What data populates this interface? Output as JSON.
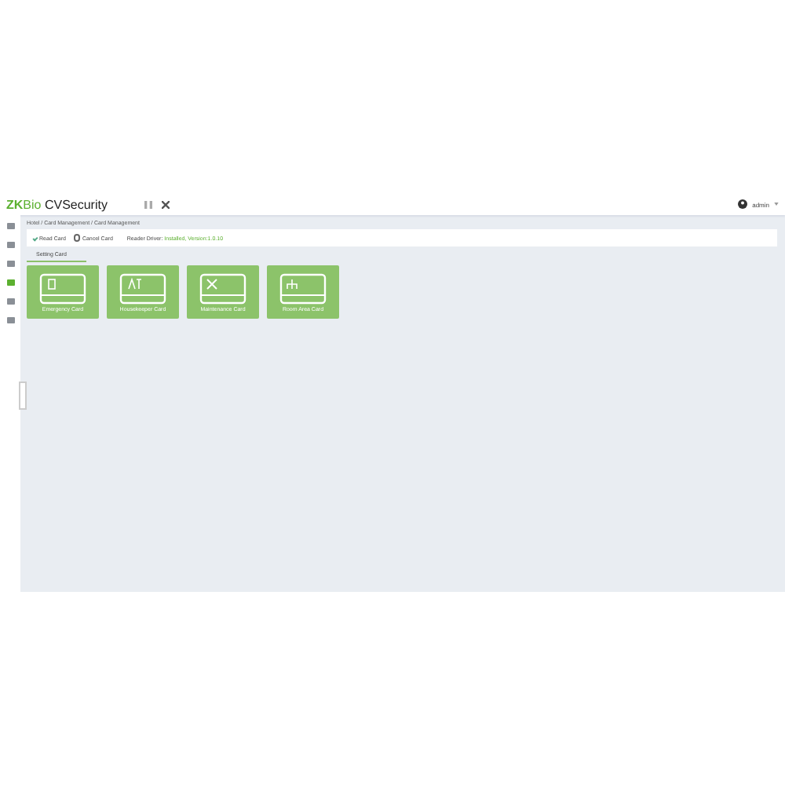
{
  "header": {
    "logo_mark": "ZK",
    "logo_brand": "Bio",
    "product": "CVSecurity",
    "user": "admin"
  },
  "sidebar": {
    "items": [
      {
        "selected": false
      },
      {
        "selected": false
      },
      {
        "selected": false
      },
      {
        "selected": true
      },
      {
        "selected": false
      },
      {
        "selected": false
      }
    ]
  },
  "breadcrumb": "Hotel / Card Management / Card Management",
  "toolbar": {
    "buttons": [
      {
        "label": "Read Card",
        "kind": "check"
      },
      {
        "label": "Cancel Card",
        "kind": "cancel"
      }
    ],
    "driver_label": "Reader Driver:",
    "driver_status": "Installed, Version:1.0.10"
  },
  "tabs": [
    {
      "label": "Setting Card",
      "selected": true
    }
  ],
  "cards": [
    {
      "label": "Emergency Card",
      "kind": "emergency"
    },
    {
      "label": "Housekeeper Card",
      "kind": "housekeeper"
    },
    {
      "label": "Maintenance Card",
      "kind": "maintenance"
    },
    {
      "label": "Room Area Card",
      "kind": "area"
    }
  ]
}
